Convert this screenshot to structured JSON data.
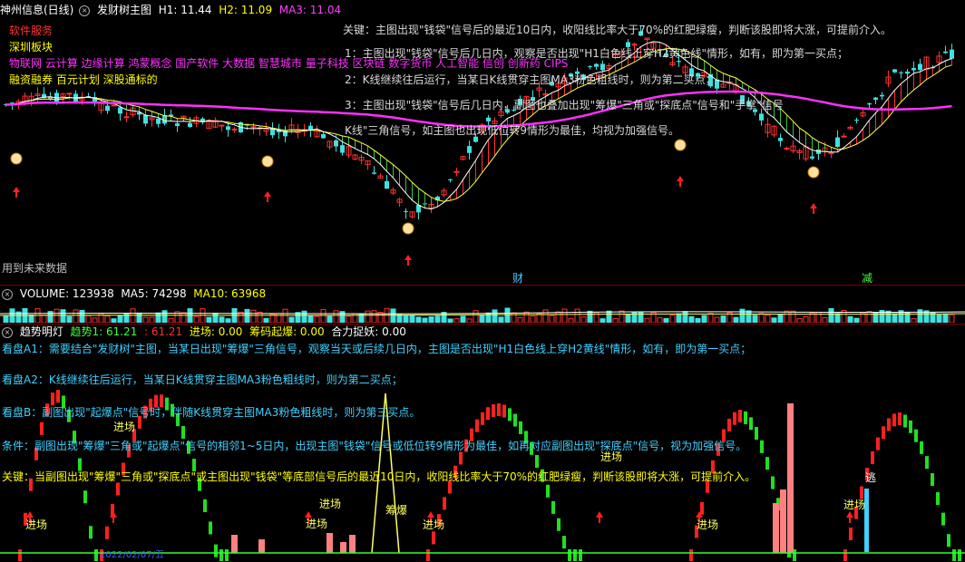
{
  "main_panel": {
    "title": "神州信息(日线)",
    "indicator": "发财树主图",
    "h1_label": "H1: 11.44",
    "h2_label": "H2: 11.09",
    "ma3_label": "MA3: 11.04",
    "left_labels": [
      {
        "text": "软件服务",
        "color": "#ff3030"
      },
      {
        "text": "深圳板块",
        "color": "#ffff00"
      },
      {
        "text": "物联网 云计算 边缘计算 鸿蒙概念 国产软件 大数据 智慧城市 量子科技 区块链 数字货币 人工智能 信创 创新药 CIPS",
        "color": "#ff30ff"
      },
      {
        "text": "融资融券 百元计划 深股通标的",
        "color": "#ffff00"
      }
    ],
    "notes": [
      "关键：主图出现\"钱袋\"信号后的最近10日内，收阳线比率大于70%的红肥绿瘦，判断该股即将大涨，可提前介入。",
      "1：主图出现\"钱袋\"信号后几日内，观察是否出现\"H1白色线上穿H2黄色线\"情形，如有，即为第一买点；",
      "2：K线继续往后运行，当某日K线贯穿主图MA3粉色粗线时，则为第二买点；",
      "3：主图出现\"钱袋\"信号后几日内，副图也叠加出现\"筹爆\"三角或\"探底点\"信号和\"手掌\"信号",
      "K线\"三角信号，如主图也出现低位转9情形为最佳，均视为加强信号。"
    ],
    "future_label": "用到未来数据",
    "marker_cai": "财",
    "marker_jian": "减"
  },
  "volume_panel": {
    "title": "VOLUME: 123938",
    "ma5": "MA5: 74298",
    "ma10": "MA10: 63968"
  },
  "trend_panel": {
    "title": "趋势明灯",
    "trend1": "趋势1: 61.21",
    "trend2": ": 61.21",
    "entry": "进场: 0.00",
    "chouma": "筹码起爆: 0.00",
    "heli": "合力捉妖: 0.00",
    "notes": [
      {
        "text": "看盘A1：需要结合\"发财树\"主图，当某日出现\"筹爆\"三角信号，观察当天或后续几日内，主图是否出现\"H1白色线上穿H2黄线\"情形，如有，即为第一买点；",
        "color": "#40d0ff"
      },
      {
        "text": "看盘A2：K线继续往后运行，当某日K线贯穿主图MA3粉色粗线时，则为第二买点；",
        "color": "#40d0ff"
      },
      {
        "text": "看盘B：副图出现\"起爆点\"信号时，伴随K线贯穿主图MA3粉色粗线时，则为第三买点。",
        "color": "#40d0ff"
      },
      {
        "text": "条件：副图出现\"筹爆\"三角或\"起爆点\"信号的相邻1~5日内，出现主图\"钱袋\"信号或低位转9情形为最佳，如再对应副图出现\"探底点\"信号，视为加强信号。",
        "color": "#40d0ff"
      },
      {
        "text": "关键：当副图出现\"筹爆\"三角或\"探底点\"或主图出现\"钱袋\"等底部信号后的最近10日内，收阳线比率大于70%的红肥绿瘦，判断该股即将大涨，可提前介入。",
        "color": "#ffff00"
      }
    ],
    "entry_label": "进场",
    "chouma_short": "筹爆",
    "escape_label": "逃",
    "date_label": "2022/02/07/五"
  }
}
